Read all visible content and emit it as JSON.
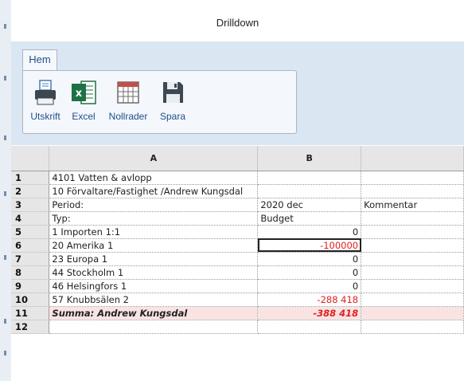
{
  "window": {
    "title": "Drilldown"
  },
  "ribbon": {
    "tab": "Hem",
    "buttons": [
      {
        "label": "Utskrift",
        "icon": "printer-icon"
      },
      {
        "label": "Excel",
        "icon": "excel-icon"
      },
      {
        "label": "Nollrader",
        "icon": "grid-icon"
      },
      {
        "label": "Spara",
        "icon": "save-icon"
      }
    ]
  },
  "sheet": {
    "columns": [
      "A",
      "B"
    ],
    "rows": [
      {
        "n": "1",
        "a": "4101 Vatten & avlopp",
        "b": "",
        "c": ""
      },
      {
        "n": "2",
        "a": "10 Förvaltare/Fastighet /Andrew Kungsdal",
        "b": "",
        "c": ""
      },
      {
        "n": "3",
        "a": "Period:",
        "b": "2020 dec",
        "c": "Kommentar"
      },
      {
        "n": "4",
        "a": "Typ:",
        "b": "Budget",
        "c": ""
      },
      {
        "n": "5",
        "a": "1 Importen 1:1",
        "b": "0",
        "c": ""
      },
      {
        "n": "6",
        "a": "20 Amerika 1",
        "b": "-100000",
        "c": ""
      },
      {
        "n": "7",
        "a": "23 Europa 1",
        "b": "0",
        "c": ""
      },
      {
        "n": "8",
        "a": "44 Stockholm 1",
        "b": "0",
        "c": ""
      },
      {
        "n": "9",
        "a": "46 Helsingfors 1",
        "b": "0",
        "c": ""
      },
      {
        "n": "10",
        "a": "57 Knubbsälen 2",
        "b": "-288 418",
        "c": ""
      },
      {
        "n": "11",
        "a": "Summa: Andrew Kungsdal",
        "b": "-388 418",
        "c": ""
      },
      {
        "n": "12",
        "a": "",
        "b": "",
        "c": ""
      }
    ]
  },
  "colors": {
    "negative": "#e02020",
    "sum_row_bg": "#f9e3e3",
    "ribbon_bg": "#dbe6f3",
    "accent": "#1f4f8a"
  }
}
